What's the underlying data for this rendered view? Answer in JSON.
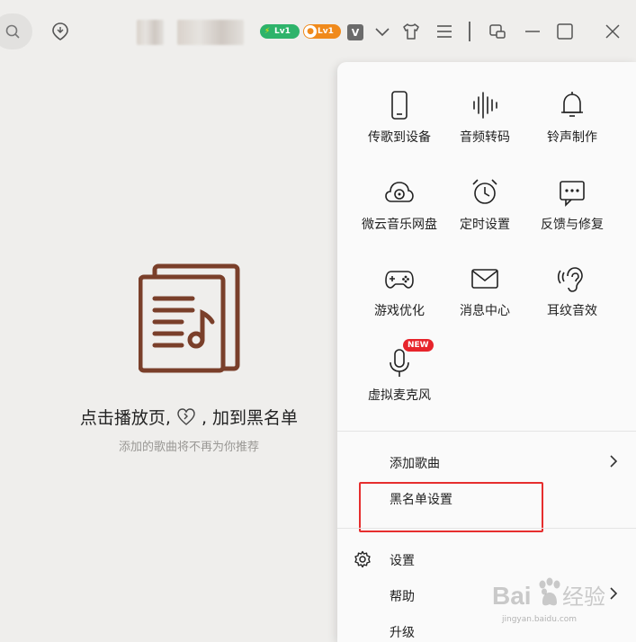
{
  "topbar": {
    "badges": [
      {
        "icon": "lightning-icon",
        "text": "Lv1",
        "color": "#2eb36a"
      },
      {
        "icon": "record-icon",
        "text": "Lv1",
        "color": "#f08a1c"
      }
    ],
    "vip_label": "V"
  },
  "empty_state": {
    "title_before": "点击播放页,",
    "title_after": ", 加到黑名单",
    "subtitle": "添加的歌曲将不再为你推荐",
    "illustration_color": "#7a3f2a"
  },
  "menu": {
    "grid": [
      {
        "label": "传歌到设备",
        "icon": "phone-icon"
      },
      {
        "label": "音频转码",
        "icon": "waveform-icon"
      },
      {
        "label": "铃声制作",
        "icon": "bell-icon"
      },
      {
        "label": "微云音乐网盘",
        "icon": "cloud-icon"
      },
      {
        "label": "定时设置",
        "icon": "alarm-clock-icon"
      },
      {
        "label": "反馈与修复",
        "icon": "feedback-icon"
      },
      {
        "label": "游戏优化",
        "icon": "gamepad-icon"
      },
      {
        "label": "消息中心",
        "icon": "mail-icon"
      },
      {
        "label": "耳纹音效",
        "icon": "ear-icon"
      },
      {
        "label": "虚拟麦克风",
        "icon": "microphone-icon",
        "badge": "NEW"
      }
    ],
    "list": {
      "add_song": "添加歌曲",
      "blacklist": "黑名单设置",
      "settings": "设置",
      "help": "帮助",
      "upgrade": "升级"
    }
  },
  "watermark": {
    "brand": "Bai",
    "brand_cn": "经验",
    "url": "jingyan.baidu.com"
  },
  "colors": {
    "background": "#efeeec",
    "menu_bg": "#fafafa",
    "highlight_box": "#e62e2e",
    "badge_new": "#e7242b"
  }
}
